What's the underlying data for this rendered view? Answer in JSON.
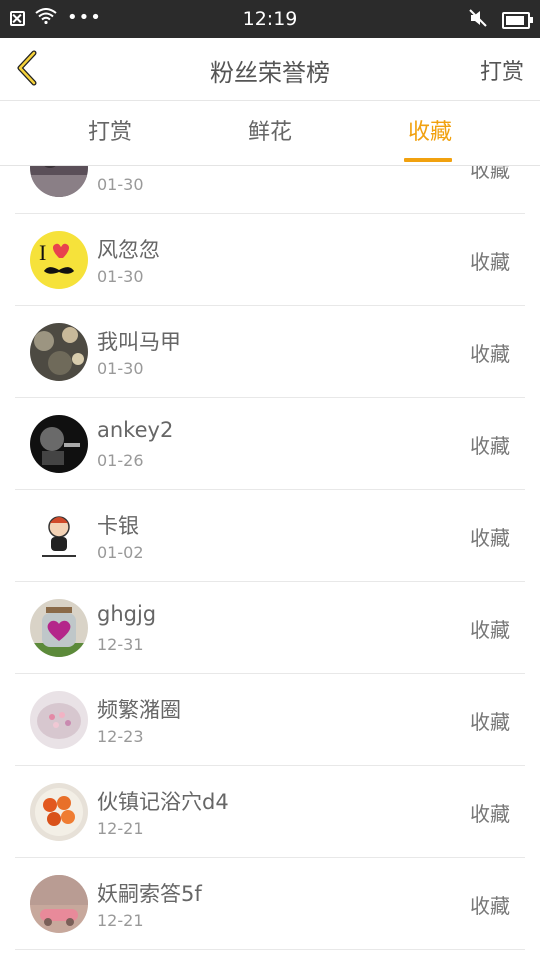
{
  "status": {
    "time": "12:19"
  },
  "nav": {
    "title": "粉丝荣誉榜",
    "right": "打赏"
  },
  "tabs": [
    {
      "label": "打赏",
      "active": false
    },
    {
      "label": "鲜花",
      "active": false
    },
    {
      "label": "收藏",
      "active": true
    }
  ],
  "accent_color": "#f1a10f",
  "list": [
    {
      "name": "",
      "date": "01-30",
      "action": "收藏",
      "avatar": "dark-photo"
    },
    {
      "name": "风忽忽",
      "date": "01-30",
      "action": "收藏",
      "avatar": "i-love-mustache"
    },
    {
      "name": "我叫马甲",
      "date": "01-30",
      "action": "收藏",
      "avatar": "rainy-window"
    },
    {
      "name": "ankey2",
      "date": "01-26",
      "action": "收藏",
      "avatar": "dark-portrait"
    },
    {
      "name": "卡银",
      "date": "01-02",
      "action": "收藏",
      "avatar": "cartoon-girl"
    },
    {
      "name": "ghgjg",
      "date": "12-31",
      "action": "收藏",
      "avatar": "heart-jar"
    },
    {
      "name": "频繁潴圈",
      "date": "12-23",
      "action": "收藏",
      "avatar": "flower-box"
    },
    {
      "name": "伙镇记浴穴d4",
      "date": "12-21",
      "action": "收藏",
      "avatar": "food-bowl"
    },
    {
      "name": "妖嗣索答5f",
      "date": "12-21",
      "action": "收藏",
      "avatar": "pink-car"
    }
  ]
}
